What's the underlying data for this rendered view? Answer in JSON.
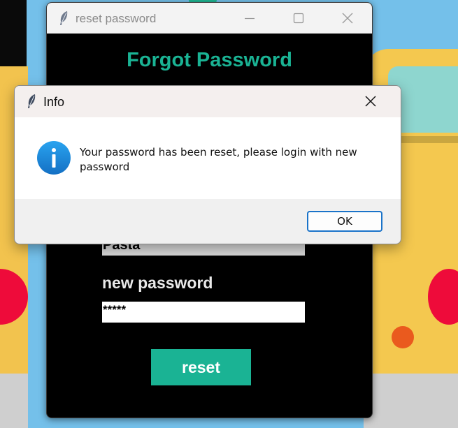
{
  "colors": {
    "accent_teal": "#1ab394",
    "window_bg": "#000000",
    "dialog_bg": "#f0f0f0",
    "ok_border": "#1a73c9",
    "info_icon": "#1b86dc"
  },
  "main_window": {
    "title": "reset password",
    "icon": "feather-icon",
    "heading": "Forgot Password",
    "username_value": "Pasta",
    "new_password_label": "new password",
    "new_password_value": "*****",
    "reset_label": "reset"
  },
  "info_dialog": {
    "title": "Info",
    "icon": "info-icon",
    "message": "Your password has been reset, please login with new password",
    "ok_label": "OK"
  }
}
